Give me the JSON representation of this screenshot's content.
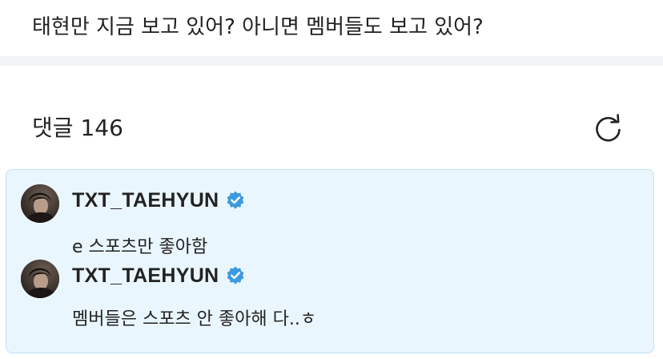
{
  "question": "태현만 지금 보고 있어? 아니면 멤버들도 보고 있어?",
  "comments_header": {
    "label": "댓글",
    "count": "146"
  },
  "colors": {
    "card_background": "#eaf6fd",
    "card_border": "#c3e2f4",
    "verified_badge": "#3b9ae1",
    "divider": "#f3f4f6"
  },
  "icons": {
    "refresh": "refresh-icon",
    "verified": "verified-badge-icon"
  },
  "thread": [
    {
      "author": "TXT_TAEHYUN",
      "verified": true,
      "text": "e 스포츠만 좋아함"
    },
    {
      "author": "TXT_TAEHYUN",
      "verified": true,
      "text": "멤버들은 스포츠 안 좋아해 다..ㅎ"
    }
  ]
}
